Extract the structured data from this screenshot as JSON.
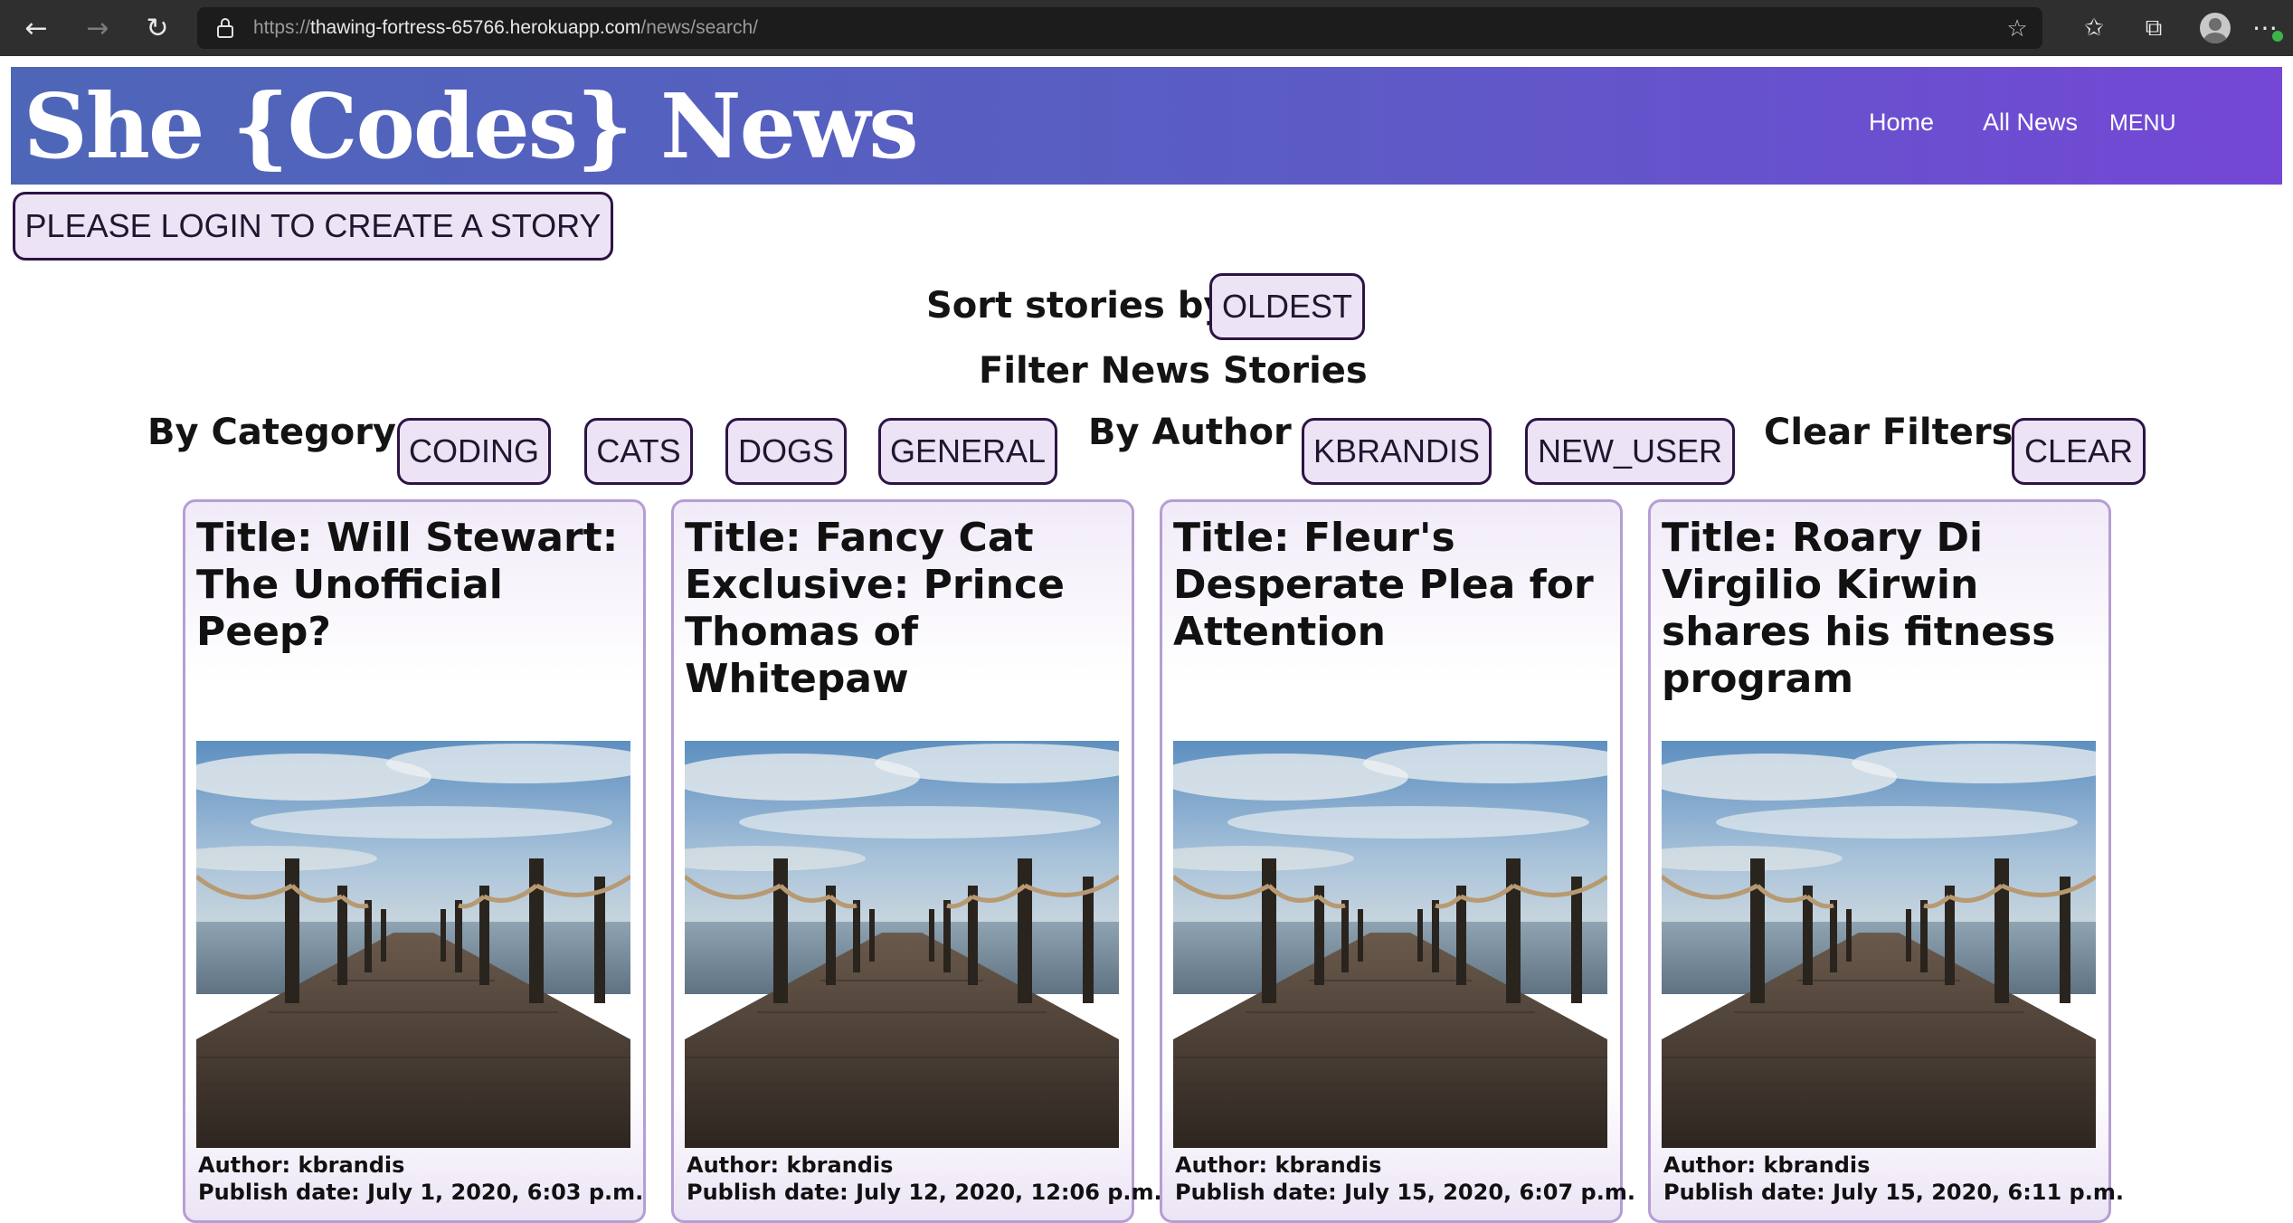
{
  "browser": {
    "url_scheme": "https://",
    "url_host": "thawing-fortress-65766.herokuapp.com",
    "url_path": "/news/search/"
  },
  "site": {
    "logo": "She {Codes} News",
    "nav": [
      "Home",
      "All News",
      "MENU"
    ]
  },
  "login_button": "PLEASE LOGIN TO CREATE A STORY",
  "sort": {
    "label": "Sort stories by:",
    "button": "OLDEST"
  },
  "filters": {
    "heading": "Filter News Stories",
    "category_label": "By Category",
    "categories": [
      "CODING",
      "CATS",
      "DOGS",
      "GENERAL"
    ],
    "author_label": "By Author",
    "authors": [
      "KBRANDIS",
      "NEW_USER"
    ],
    "clear_label": "Clear Filters",
    "clear_button": "CLEAR"
  },
  "stories": [
    {
      "title": "Title: Will Stewart: The Unofficial Peep?",
      "author": "Author: kbrandis",
      "date": "Publish date: July 1, 2020, 6:03 p.m."
    },
    {
      "title": "Title: Fancy Cat Exclusive: Prince Thomas of Whitepaw",
      "author": "Author: kbrandis",
      "date": "Publish date: July 12, 2020, 12:06 p.m."
    },
    {
      "title": "Title: Fleur's Desperate Plea for Attention",
      "author": "Author: kbrandis",
      "date": "Publish date: July 15, 2020, 6:07 p.m."
    },
    {
      "title": "Title: Roary Di Virgilio Kirwin shares his fitness program",
      "author": "Author: kbrandis",
      "date": "Publish date: July 15, 2020, 6:11 p.m."
    }
  ],
  "colors": {
    "header_gradient_start": "#4e66b8",
    "header_gradient_end": "#7447d6",
    "button_fill": "#ece4f5",
    "button_border": "#2d1446",
    "card_border": "#b59ed4"
  },
  "icons": [
    "back-arrow-icon",
    "forward-arrow-icon",
    "refresh-icon",
    "lock-icon",
    "add-favorite-icon",
    "favorites-icon",
    "collections-icon",
    "profile-icon",
    "more-icon"
  ]
}
